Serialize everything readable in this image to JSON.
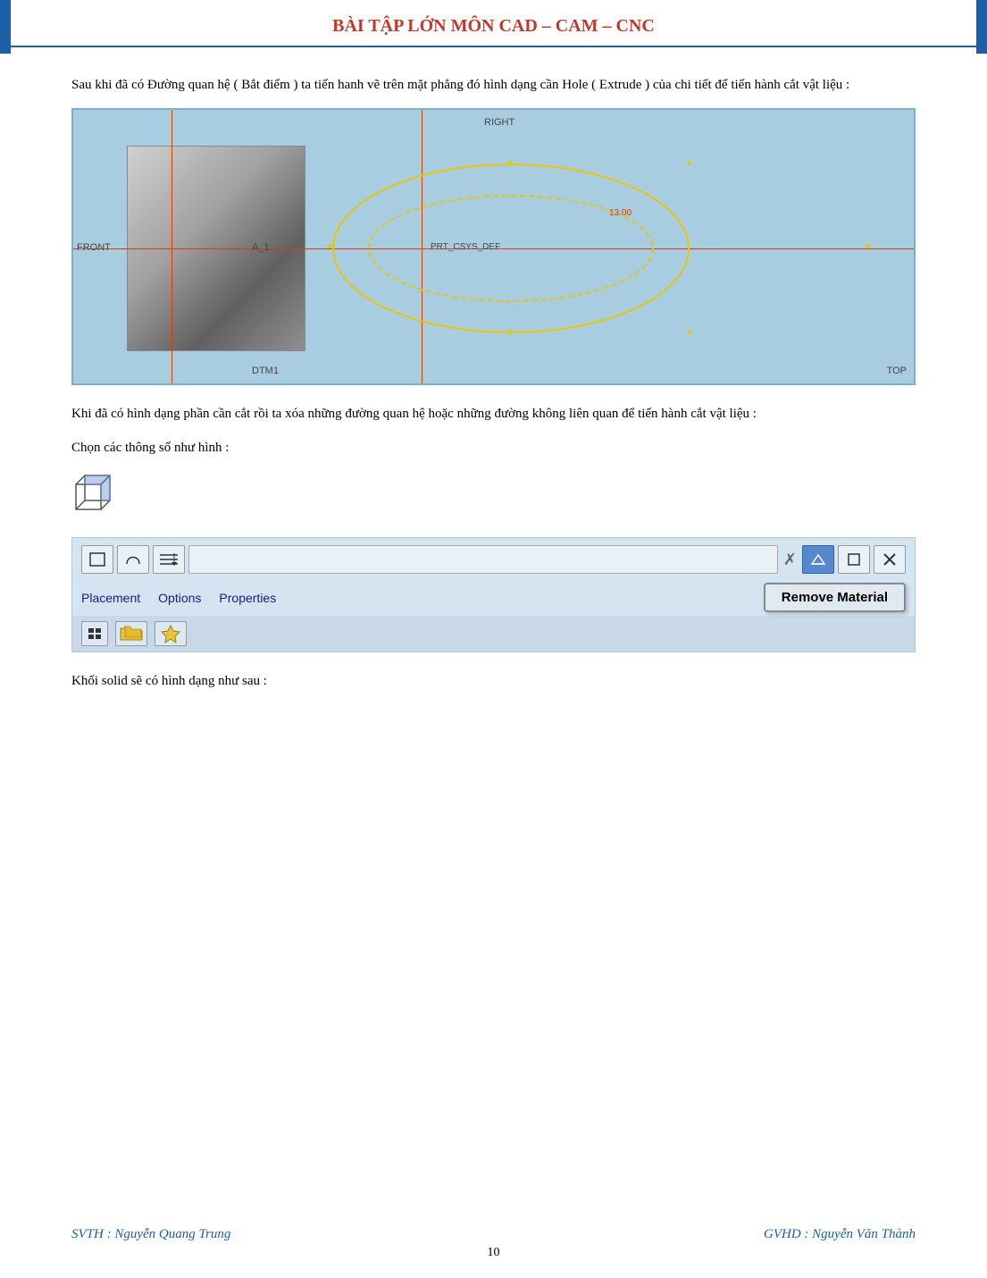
{
  "header": {
    "title": "BÀI TẬP LỚN MÔN CAD – CAM – CNC"
  },
  "paragraphs": {
    "p1": "Sau khi đã có Đường quan hệ ( Bắt điểm ) ta tiến hanh vẽ trên mặt phẳng đó hình dạng cần Hole ( Extrude ) của chi tiết để tiến hành cắt vật liệu :",
    "p2": "Khi đã có hình dạng phần cần cắt rồi ta xóa những đường quan hệ hoặc những đường không liên quan để tiến hành cắt vật liệu :",
    "p3": "Chọn các thông số như hình :",
    "p4": "Khối solid sẽ có hình dạng như sau :"
  },
  "cad": {
    "label_right": "RIGHT",
    "label_front": "FRONT",
    "label_a1": "A_1",
    "label_prt": "PRT_CSYS_DEF",
    "label_dtm1": "DTM1",
    "label_top": "TOP",
    "label_dim": "13.00"
  },
  "toolbar": {
    "tabs": [
      {
        "label": "Placement"
      },
      {
        "label": "Options"
      },
      {
        "label": "Properties"
      }
    ],
    "remove_material_label": "Remove Material"
  },
  "footer": {
    "left": "SVTH : Nguyễn Quang Trung",
    "right": "GVHD : Nguyễn Văn Thành",
    "page": "10"
  }
}
